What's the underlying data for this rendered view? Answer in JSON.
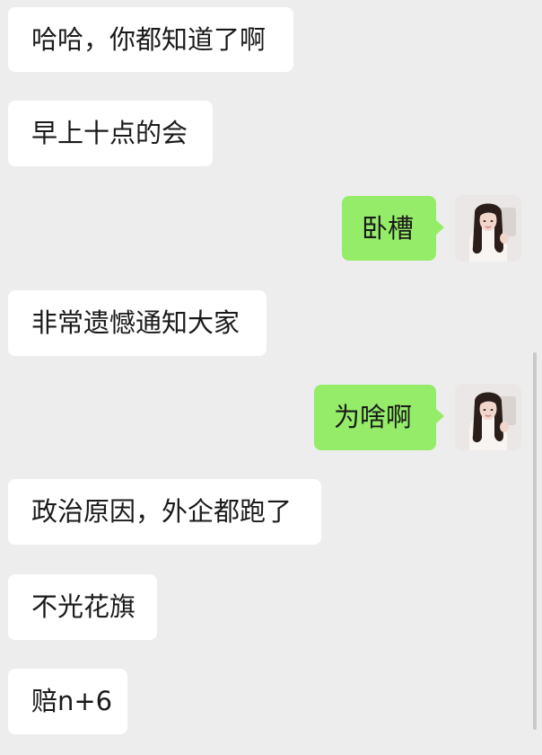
{
  "chat": {
    "messages": [
      {
        "sender": "other",
        "text": "哈哈，你都知道了啊"
      },
      {
        "sender": "other",
        "text": "早上十点的会"
      },
      {
        "sender": "self",
        "text": "卧槽"
      },
      {
        "sender": "other",
        "text": "非常遗憾通知大家"
      },
      {
        "sender": "self",
        "text": "为啥啊"
      },
      {
        "sender": "other",
        "text": "政治原因，外企都跑了"
      },
      {
        "sender": "other",
        "text": "不光花旗"
      },
      {
        "sender": "other",
        "text": "赔n+6"
      }
    ]
  },
  "colors": {
    "background": "#ededed",
    "incoming_bubble": "#ffffff",
    "outgoing_bubble": "#95ec69",
    "text": "#1a1a1a"
  },
  "icons": {
    "self_avatar": "user-avatar-photo"
  }
}
